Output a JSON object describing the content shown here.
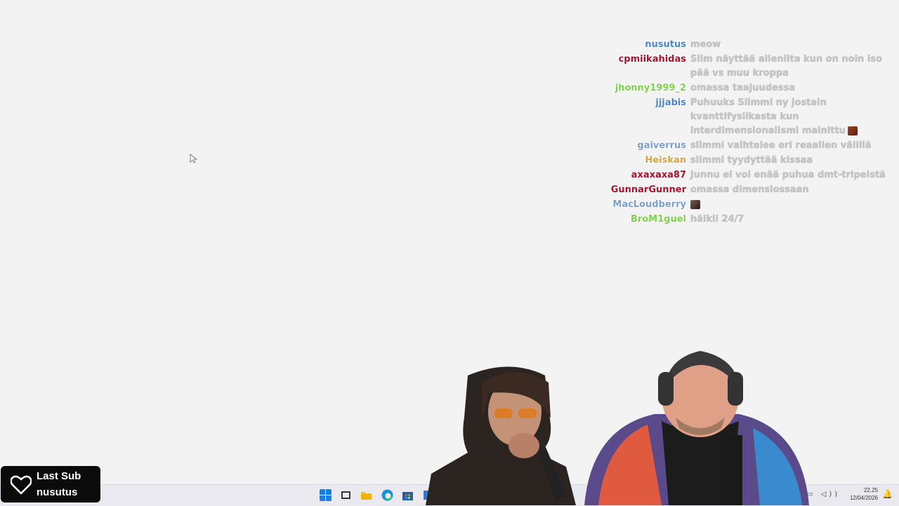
{
  "chat": {
    "messages": [
      {
        "user": "nusutus",
        "color": "#4a86d4",
        "text": "meow"
      },
      {
        "user": "cpmiikahidas",
        "color": "#b0102a",
        "text": "Slim näyttää alienilta kun on noin iso pää vs muu kroppa"
      },
      {
        "user": "jhonny1999_2",
        "color": "#7bd44a",
        "text": "omassa taajuudessa"
      },
      {
        "user": "jjjabis",
        "color": "#4a86d4",
        "text": "Puhuuks Slimmi ny jostain kvanttifysiikasta kun interdimensionalismi mainittu",
        "emote": "brown"
      },
      {
        "user": "gaiverrus",
        "color": "#7d9ed6",
        "text": "slimmi vaihtelee eri reaalien välillä"
      },
      {
        "user": "Heiskan",
        "color": "#e0a040",
        "text": "slimmi tyydyttää kissaa"
      },
      {
        "user": "axaxaxa87",
        "color": "#b0102a",
        "text": "Junnu ei voi enää puhua dmt-tripeistä"
      },
      {
        "user": "GunnarGunner",
        "color": "#b0102a",
        "text": "omassa dimensiossaan"
      },
      {
        "user": "MacLoudberry",
        "color": "#7d9ed6",
        "text": "",
        "emote": "dark"
      },
      {
        "user": "BroM1guel",
        "color": "#7bd44a",
        "text": "häikii 24/7"
      }
    ]
  },
  "widget": {
    "line1": "Last Sub",
    "line2": "nusutus"
  },
  "tray": {
    "time": "22.25",
    "date": "12/04/2026"
  }
}
